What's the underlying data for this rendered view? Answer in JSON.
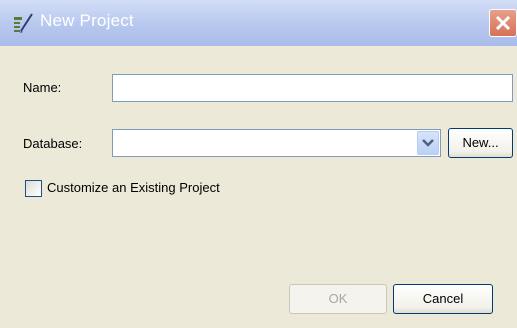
{
  "window": {
    "title": "New Project"
  },
  "form": {
    "name_label": "Name:",
    "name_value": "",
    "database_label": "Database:",
    "database_value": "",
    "new_button_label": "New...",
    "customize_label": "Customize an Existing Project",
    "customize_checked": false
  },
  "footer": {
    "ok_label": "OK",
    "cancel_label": "Cancel"
  },
  "colors": {
    "title_bar": "#b9c9ef",
    "close_button": "#d67257",
    "field_border": "#7f9db9",
    "dialog_bg": "#ece9d8"
  },
  "icons": {
    "app_icon": "pen-and-list-icon",
    "close_icon": "close-x-icon",
    "dropdown_icon": "chevron-down-icon"
  }
}
